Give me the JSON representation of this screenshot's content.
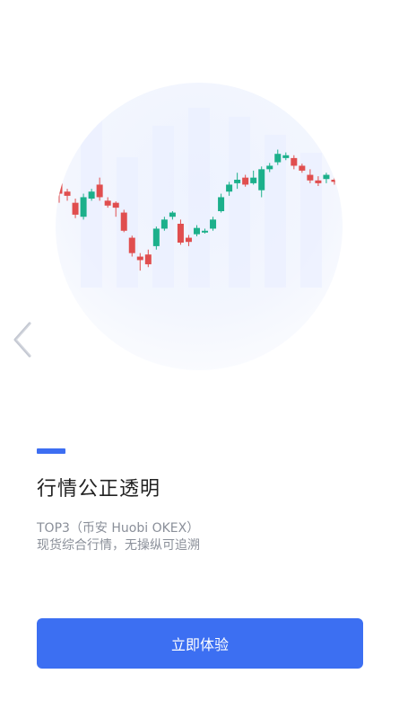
{
  "onboarding": {
    "title": "行情公正透明",
    "description_line1": "TOP3（币安 Huobi OKEX）",
    "description_line2": "现货综合行情，无操纵可追溯",
    "cta_label": "立即体验"
  },
  "colors": {
    "accent": "#3c6ff2",
    "candle_up": "#1cb08b",
    "candle_down": "#e04e4e"
  },
  "icons": {
    "back": "chevron-left-icon",
    "illustration": "candlestick-chart-illustration"
  },
  "chart_data": {
    "type": "candlestick",
    "candles": [
      {
        "o": 0.75,
        "c": 0.55,
        "h": 0.8,
        "l": 0.42
      },
      {
        "o": 0.58,
        "c": 0.52,
        "h": 0.62,
        "l": 0.45
      },
      {
        "o": 0.42,
        "c": 0.25,
        "h": 0.48,
        "l": 0.2
      },
      {
        "o": 0.22,
        "c": 0.5,
        "h": 0.55,
        "l": 0.18
      },
      {
        "o": 0.48,
        "c": 0.58,
        "h": 0.62,
        "l": 0.45
      },
      {
        "o": 0.68,
        "c": 0.5,
        "h": 0.78,
        "l": 0.45
      },
      {
        "o": 0.45,
        "c": 0.38,
        "h": 0.5,
        "l": 0.35
      },
      {
        "o": 0.42,
        "c": 0.35,
        "h": 0.44,
        "l": 0.22
      },
      {
        "o": 0.28,
        "c": 0.02,
        "h": 0.32,
        "l": 0.0
      },
      {
        "o": -0.08,
        "c": -0.3,
        "h": -0.05,
        "l": -0.35
      },
      {
        "o": -0.35,
        "c": -0.4,
        "h": -0.3,
        "l": -0.55
      },
      {
        "o": -0.32,
        "c": -0.46,
        "h": -0.25,
        "l": -0.5
      },
      {
        "o": -0.2,
        "c": 0.05,
        "h": 0.08,
        "l": -0.25
      },
      {
        "o": 0.05,
        "c": 0.18,
        "h": 0.22,
        "l": 0.02
      },
      {
        "o": 0.22,
        "c": 0.28,
        "h": 0.3,
        "l": 0.18
      },
      {
        "o": 0.12,
        "c": -0.15,
        "h": 0.18,
        "l": -0.18
      },
      {
        "o": -0.08,
        "c": -0.14,
        "h": -0.04,
        "l": -0.2
      },
      {
        "o": -0.03,
        "c": 0.06,
        "h": 0.1,
        "l": -0.06
      },
      {
        "o": 0.0,
        "c": 0.02,
        "h": 0.05,
        "l": -0.02
      },
      {
        "o": 0.05,
        "c": 0.18,
        "h": 0.22,
        "l": 0.02
      },
      {
        "o": 0.3,
        "c": 0.5,
        "h": 0.55,
        "l": 0.28
      },
      {
        "o": 0.58,
        "c": 0.68,
        "h": 0.72,
        "l": 0.52
      },
      {
        "o": 0.7,
        "c": 0.75,
        "h": 0.85,
        "l": 0.62
      },
      {
        "o": 0.78,
        "c": 0.68,
        "h": 0.82,
        "l": 0.65
      },
      {
        "o": 0.7,
        "c": 0.78,
        "h": 0.88,
        "l": 0.68
      },
      {
        "o": 0.6,
        "c": 0.9,
        "h": 0.94,
        "l": 0.5
      },
      {
        "o": 0.9,
        "c": 0.95,
        "h": 0.99,
        "l": 0.86
      },
      {
        "o": 1.0,
        "c": 1.12,
        "h": 1.18,
        "l": 0.96
      },
      {
        "o": 1.06,
        "c": 1.1,
        "h": 1.14,
        "l": 1.03
      },
      {
        "o": 1.06,
        "c": 0.95,
        "h": 1.1,
        "l": 0.9
      },
      {
        "o": 0.95,
        "c": 0.88,
        "h": 0.98,
        "l": 0.85
      },
      {
        "o": 0.82,
        "c": 0.74,
        "h": 0.9,
        "l": 0.7
      },
      {
        "o": 0.74,
        "c": 0.7,
        "h": 0.8,
        "l": 0.66
      },
      {
        "o": 0.76,
        "c": 0.82,
        "h": 0.85,
        "l": 0.7
      },
      {
        "o": 0.75,
        "c": 0.72,
        "h": 0.8,
        "l": 0.68
      },
      {
        "o": 0.8,
        "c": 0.84,
        "h": 0.86,
        "l": 0.74
      }
    ]
  }
}
